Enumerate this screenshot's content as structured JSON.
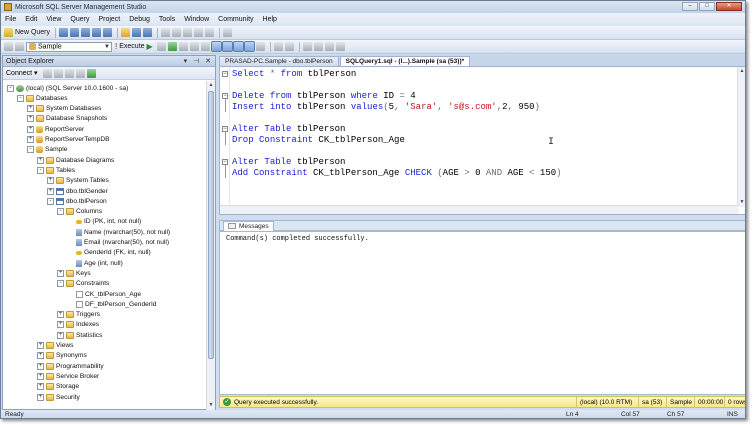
{
  "window": {
    "title": "Microsoft SQL Server Management Studio"
  },
  "menu": [
    "File",
    "Edit",
    "View",
    "Query",
    "Project",
    "Debug",
    "Tools",
    "Window",
    "Community",
    "Help"
  ],
  "toolbar": {
    "new_query": "New Query"
  },
  "sql_toolbar": {
    "database": "Sample",
    "execute": "Execute"
  },
  "object_explorer": {
    "title": "Object Explorer",
    "connect": "Connect",
    "tree": [
      {
        "label": "(local) (SQL Server 10.0.1600 - sa)",
        "icon": "server",
        "toggle": "-"
      },
      {
        "label": "Databases",
        "icon": "folder",
        "toggle": "-"
      },
      {
        "label": "System Databases",
        "icon": "folder",
        "toggle": "+"
      },
      {
        "label": "Database Snapshots",
        "icon": "folder",
        "toggle": "+"
      },
      {
        "label": "ReportServer",
        "icon": "db",
        "toggle": "+"
      },
      {
        "label": "ReportServerTempDB",
        "icon": "db",
        "toggle": "+"
      },
      {
        "label": "Sample",
        "icon": "db",
        "toggle": "-"
      },
      {
        "label": "Database Diagrams",
        "icon": "folder",
        "toggle": "+"
      },
      {
        "label": "Tables",
        "icon": "folder",
        "toggle": "-"
      },
      {
        "label": "System Tables",
        "icon": "folder",
        "toggle": "+"
      },
      {
        "label": "dbo.tblGender",
        "icon": "table",
        "toggle": "+"
      },
      {
        "label": "dbo.tblPerson",
        "icon": "table",
        "toggle": "-"
      },
      {
        "label": "Columns",
        "icon": "folder",
        "toggle": "-"
      },
      {
        "label": "ID (PK, int, not null)",
        "icon": "key",
        "toggle": ""
      },
      {
        "label": "Name (nvarchar(50), not null)",
        "icon": "col",
        "toggle": ""
      },
      {
        "label": "Email (nvarchar(50), not null)",
        "icon": "col",
        "toggle": ""
      },
      {
        "label": "GenderId (FK, int, null)",
        "icon": "key",
        "toggle": ""
      },
      {
        "label": "Age (int, null)",
        "icon": "col",
        "toggle": ""
      },
      {
        "label": "Keys",
        "icon": "folder",
        "toggle": "+"
      },
      {
        "label": "Constraints",
        "icon": "folder",
        "toggle": "-"
      },
      {
        "label": "CK_tblPerson_Age",
        "icon": "cons",
        "toggle": ""
      },
      {
        "label": "DF_tblPerson_GenderId",
        "icon": "cons",
        "toggle": ""
      },
      {
        "label": "Triggers",
        "icon": "folder",
        "toggle": "+"
      },
      {
        "label": "Indexes",
        "icon": "folder",
        "toggle": "+"
      },
      {
        "label": "Statistics",
        "icon": "folder",
        "toggle": "+"
      },
      {
        "label": "Views",
        "icon": "folder",
        "toggle": "+"
      },
      {
        "label": "Synonyms",
        "icon": "folder",
        "toggle": "+"
      },
      {
        "label": "Programmability",
        "icon": "folder",
        "toggle": "+"
      },
      {
        "label": "Service Broker",
        "icon": "folder",
        "toggle": "+"
      },
      {
        "label": "Storage",
        "icon": "folder",
        "toggle": "+"
      },
      {
        "label": "Security",
        "icon": "folder",
        "toggle": "+"
      }
    ]
  },
  "tabs": [
    {
      "label": "PRASAD-PC.Sample - dbo.tblPerson",
      "active": false
    },
    {
      "label": "SQLQuery1.sql - (l...).Sample (sa (53))*",
      "active": true
    }
  ],
  "editor": {
    "lines": [
      [
        {
          "t": "Select",
          "c": "kw"
        },
        {
          "t": " ",
          "c": "plain"
        },
        {
          "t": "*",
          "c": "op"
        },
        {
          "t": " ",
          "c": "plain"
        },
        {
          "t": "from",
          "c": "kw"
        },
        {
          "t": " tblPerson",
          "c": "plain"
        }
      ],
      [],
      [
        {
          "t": "Delete",
          "c": "kw"
        },
        {
          "t": " ",
          "c": "plain"
        },
        {
          "t": "from",
          "c": "kw"
        },
        {
          "t": " tblPerson ",
          "c": "plain"
        },
        {
          "t": "where",
          "c": "kw"
        },
        {
          "t": " ID ",
          "c": "plain"
        },
        {
          "t": "=",
          "c": "op"
        },
        {
          "t": " 4",
          "c": "plain"
        }
      ],
      [
        {
          "t": "Insert",
          "c": "kw"
        },
        {
          "t": " ",
          "c": "plain"
        },
        {
          "t": "into",
          "c": "kw"
        },
        {
          "t": " tblPerson ",
          "c": "plain"
        },
        {
          "t": "values",
          "c": "kw"
        },
        {
          "t": "(",
          "c": "op"
        },
        {
          "t": "5",
          "c": "plain"
        },
        {
          "t": ",",
          "c": "op"
        },
        {
          "t": " ",
          "c": "plain"
        },
        {
          "t": "'Sara'",
          "c": "str"
        },
        {
          "t": ",",
          "c": "op"
        },
        {
          "t": " ",
          "c": "plain"
        },
        {
          "t": "'s@s.com'",
          "c": "str"
        },
        {
          "t": ",",
          "c": "op"
        },
        {
          "t": "2",
          "c": "plain"
        },
        {
          "t": ",",
          "c": "op"
        },
        {
          "t": " 950",
          "c": "plain"
        },
        {
          "t": ")",
          "c": "op"
        }
      ],
      [],
      [
        {
          "t": "Alter",
          "c": "kw"
        },
        {
          "t": " ",
          "c": "plain"
        },
        {
          "t": "Table",
          "c": "kw"
        },
        {
          "t": " tblPerson",
          "c": "plain"
        }
      ],
      [
        {
          "t": "Drop",
          "c": "kw"
        },
        {
          "t": " ",
          "c": "plain"
        },
        {
          "t": "Constraint",
          "c": "kw"
        },
        {
          "t": " CK_tblPerson_Age",
          "c": "plain"
        }
      ],
      [],
      [
        {
          "t": "Alter",
          "c": "kw"
        },
        {
          "t": " ",
          "c": "plain"
        },
        {
          "t": "Table",
          "c": "kw"
        },
        {
          "t": " tblPerson",
          "c": "plain"
        }
      ],
      [
        {
          "t": "Add",
          "c": "kw"
        },
        {
          "t": " ",
          "c": "plain"
        },
        {
          "t": "Constraint",
          "c": "kw"
        },
        {
          "t": " CK_tblPerson_Age ",
          "c": "plain"
        },
        {
          "t": "CHECK",
          "c": "kw"
        },
        {
          "t": " ",
          "c": "plain"
        },
        {
          "t": "(",
          "c": "op"
        },
        {
          "t": "AGE ",
          "c": "plain"
        },
        {
          "t": ">",
          "c": "op"
        },
        {
          "t": " 0 ",
          "c": "plain"
        },
        {
          "t": "AND",
          "c": "op"
        },
        {
          "t": " AGE ",
          "c": "plain"
        },
        {
          "t": "<",
          "c": "op"
        },
        {
          "t": " 150",
          "c": "plain"
        },
        {
          "t": ")",
          "c": "op"
        }
      ]
    ]
  },
  "results": {
    "tab": "Messages",
    "message": "Command(s) completed successfully."
  },
  "query_status": {
    "message": "Query executed successfully.",
    "server": "(local) (10.0 RTM)",
    "user": "sa (53)",
    "database": "Sample",
    "elapsed": "00:00:00",
    "rows": "0 rows"
  },
  "status_bar": {
    "state": "Ready",
    "line": "Ln 4",
    "col": "Col 57",
    "ch": "Ch 57",
    "mode": "INS"
  },
  "colors": {
    "keyword": "#1b22d8",
    "string": "#c4161c",
    "operator": "#6b6b6b",
    "status_ok": "#3a9c3a"
  }
}
